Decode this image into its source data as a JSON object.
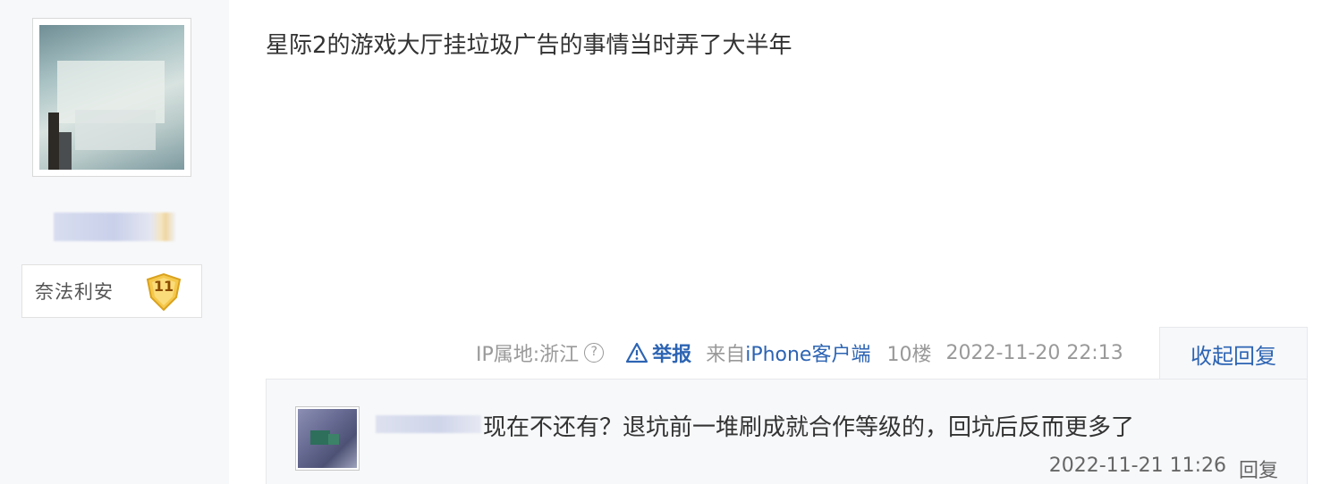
{
  "author": {
    "badge_name": "奈法利安",
    "badge_level": "11"
  },
  "post": {
    "content": "星际2的游戏大厅挂垃圾广告的事情当时弄了大半年",
    "meta": {
      "ip_location": "IP属地:浙江",
      "report_label": "举报",
      "client_prefix": "来自",
      "client_brand": "iPhone客户端",
      "floor": "10楼",
      "datetime": "2022-11-20 22:13"
    },
    "collapse_reply_label": "收起回复"
  },
  "reply": {
    "content": "现在不还有？退坑前一堆刷成就合作等级的，回坑后反而更多了",
    "datetime": "2022-11-21 11:26",
    "reply_label": "回复"
  },
  "colors": {
    "link_blue": "#2d64b3",
    "meta_gray": "#999999",
    "panel_bg": "#f7f8fa",
    "badge_gold": "#f5c84c"
  },
  "icons": [
    "help-circle-icon",
    "warning-triangle-icon",
    "level-shield-icon"
  ]
}
